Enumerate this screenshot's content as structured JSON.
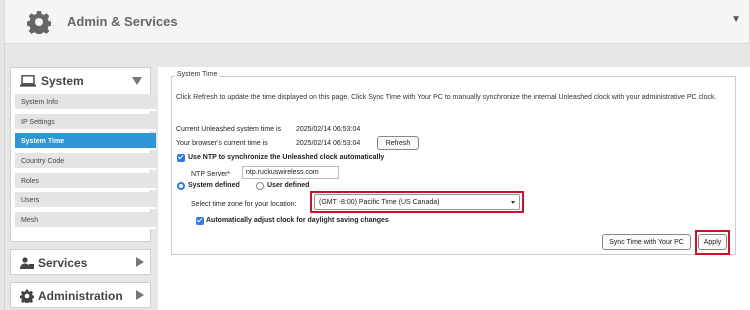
{
  "header": {
    "title": "Admin & Services",
    "icon": "gear-icon"
  },
  "sidebar": {
    "section_label": "System",
    "items": [
      {
        "label": "System Info",
        "active": false
      },
      {
        "label": "IP Settings",
        "active": false
      },
      {
        "label": "System Time",
        "active": true
      },
      {
        "label": "Country Code",
        "active": false
      },
      {
        "label": "Roles",
        "active": false
      },
      {
        "label": "Users",
        "active": false
      },
      {
        "label": "Mesh",
        "active": false
      }
    ],
    "services_label": "Services",
    "administration_label": "Administration"
  },
  "system_time": {
    "legend": "System Time",
    "description": "Click Refresh to update the time displayed on this page. Click Sync Time with Your PC to manually synchronize the internal Unleashed clock with your administrative PC clock.",
    "current_label": "Current Unleashed system time is",
    "current_value": "2025/02/14 06:53:04",
    "browser_label": "Your browser's current time is",
    "browser_value": "2025/02/14 06:53:04",
    "refresh_label": "Refresh",
    "use_ntp_label": "Use NTP to synchronize the Unleashed clock automatically",
    "use_ntp_checked": true,
    "ntp_server_label": "NTP Server*",
    "ntp_server_value": "ntp.ruckuswireless.com",
    "system_defined_label": "System defined",
    "user_defined_label": "User defined",
    "timezone_label": "Select time zone for your location:",
    "timezone_value": "(GMT -8:00) Pacific Time (US Canada)",
    "dst_label": "Automatically adjust clock for daylight saving changes",
    "dst_checked": true,
    "sync_label": "Sync Time with Your PC",
    "apply_label": "Apply"
  },
  "colors": {
    "accent": "#2e95d6",
    "highlight": "#d0102a"
  }
}
